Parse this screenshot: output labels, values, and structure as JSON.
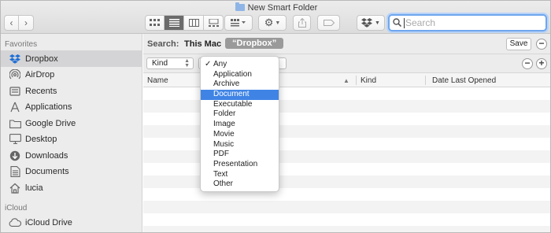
{
  "window": {
    "title": "New Smart Folder"
  },
  "search": {
    "placeholder": "Search"
  },
  "sidebar": {
    "favorites_header": "Favorites",
    "icloud_header": "iCloud",
    "items": [
      {
        "label": "Dropbox",
        "icon": "dropbox-icon",
        "selected": true
      },
      {
        "label": "AirDrop",
        "icon": "airdrop-icon"
      },
      {
        "label": "Recents",
        "icon": "recents-icon"
      },
      {
        "label": "Applications",
        "icon": "applications-icon"
      },
      {
        "label": "Google Drive",
        "icon": "folder-icon"
      },
      {
        "label": "Desktop",
        "icon": "desktop-icon"
      },
      {
        "label": "Downloads",
        "icon": "downloads-icon"
      },
      {
        "label": "Documents",
        "icon": "documents-icon"
      },
      {
        "label": "lucia",
        "icon": "home-icon"
      }
    ],
    "icloud_items": [
      {
        "label": "iCloud Drive",
        "icon": "icloud-icon"
      }
    ]
  },
  "searchbar": {
    "label": "Search:",
    "scope_this_mac": "This Mac",
    "scope_selected": "“Dropbox”",
    "save_label": "Save",
    "remove_symbol": "−",
    "add_symbol": "+"
  },
  "criteria": {
    "attribute": "Kind"
  },
  "columns": {
    "name": "Name",
    "kind": "Kind",
    "date": "Date Last Opened"
  },
  "menu": {
    "checked": "Any",
    "highlighted": "Document",
    "items": [
      "Any",
      "Application",
      "Archive",
      "Document",
      "Executable",
      "Folder",
      "Image",
      "Movie",
      "Music",
      "PDF",
      "Presentation",
      "Text",
      "Other"
    ]
  },
  "colors": {
    "accent": "#3f84e5",
    "search_focus": "#6fa6ee",
    "dropbox": "#1f6fd6"
  }
}
